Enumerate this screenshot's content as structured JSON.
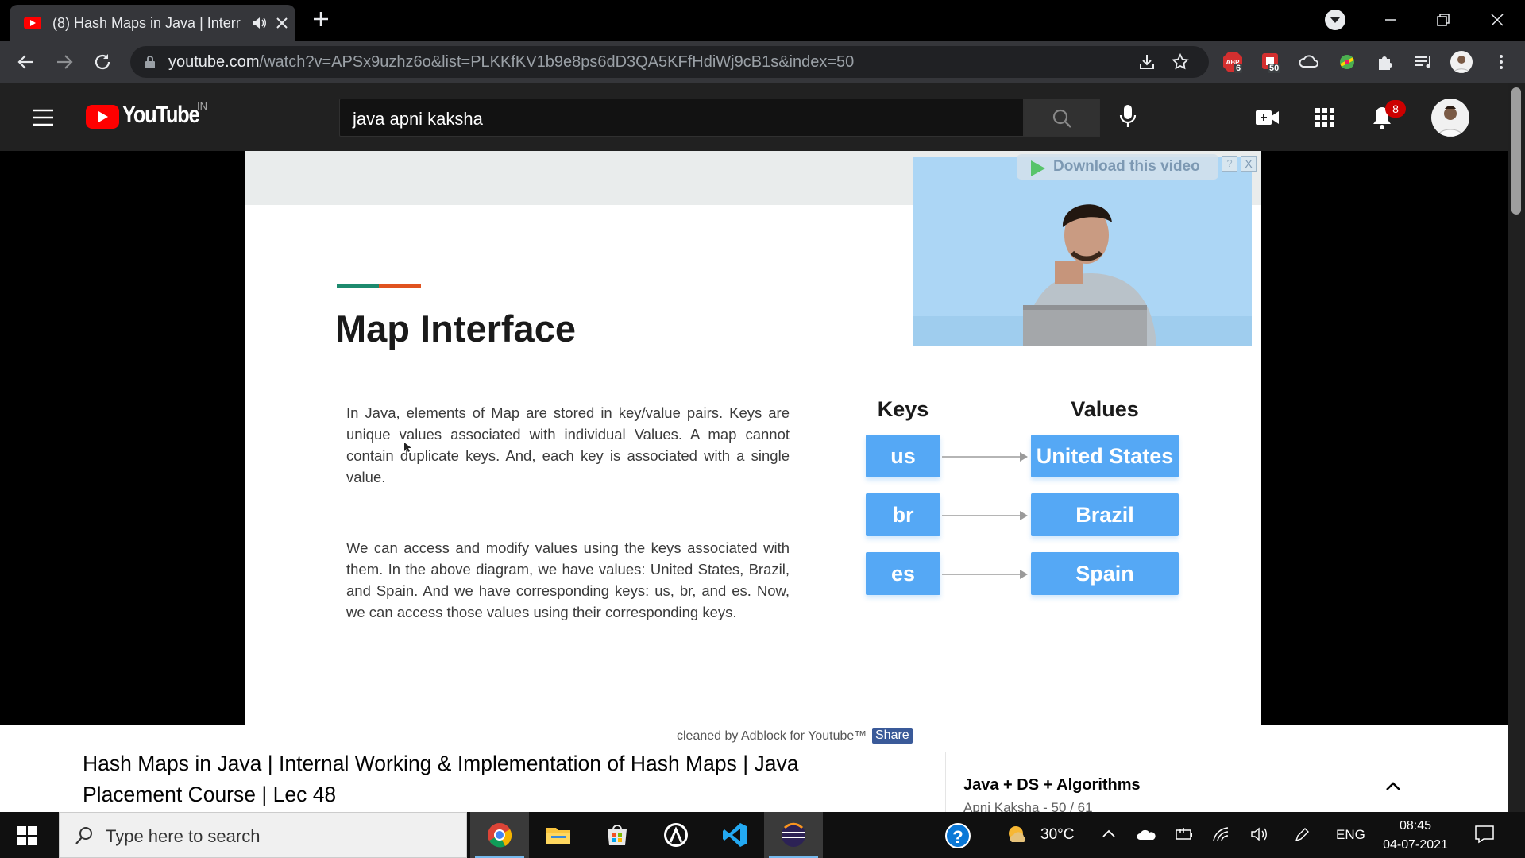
{
  "browser": {
    "tab_title": "(8) Hash Maps in Java | Interr",
    "url_domain": "youtube.com",
    "url_path": "/watch?v=APSx9uzhz6o&list=PLKKfKV1b9e8ps6dD3QA5KFfHdiWj9cB1s&index=50",
    "ext_abp_count": "6",
    "ext_red_count": "50"
  },
  "youtube": {
    "logo_text": "YouTube",
    "country_code": "IN",
    "search_value": "java apni kaksha",
    "notification_count": "8"
  },
  "slide": {
    "title": "Map Interface",
    "paragraph1": "In Java, elements of Map are stored in key/value pairs. Keys are unique values associated with individual Values. A map cannot contain duplicate keys. And, each key is associated with a single value.",
    "paragraph2": "We can access and modify values using the keys associated with them. In the above diagram, we have values: United States, Brazil, and Spain. And we have corresponding keys: us, br, and es. Now, we can access those values using their corresponding keys.",
    "keys_header": "Keys",
    "values_header": "Values",
    "pairs": [
      {
        "key": "us",
        "value": "United States"
      },
      {
        "key": "br",
        "value": "Brazil"
      },
      {
        "key": "es",
        "value": "Spain"
      }
    ],
    "download_label": "Download this video",
    "download_help": "?",
    "download_close": "X"
  },
  "video": {
    "adblock_note": "cleaned by Adblock for Youtube™",
    "share_label": "Share",
    "title": "Hash Maps in Java | Internal Working & Implementation of Hash Maps | Java Placement Course | Lec 48",
    "playlist_title": "Java + DS + Algorithms",
    "playlist_sub": "Apni Kaksha - 50 / 61"
  },
  "taskbar": {
    "search_placeholder": "Type here to search",
    "temperature": "30°C",
    "language": "ENG",
    "time": "08:45",
    "date": "04-07-2021"
  },
  "colors": {
    "youtube_red": "#ff0000",
    "slide_box_blue": "#55a8f5",
    "accent_green": "#1d8a6e",
    "accent_orange": "#e0531f"
  }
}
